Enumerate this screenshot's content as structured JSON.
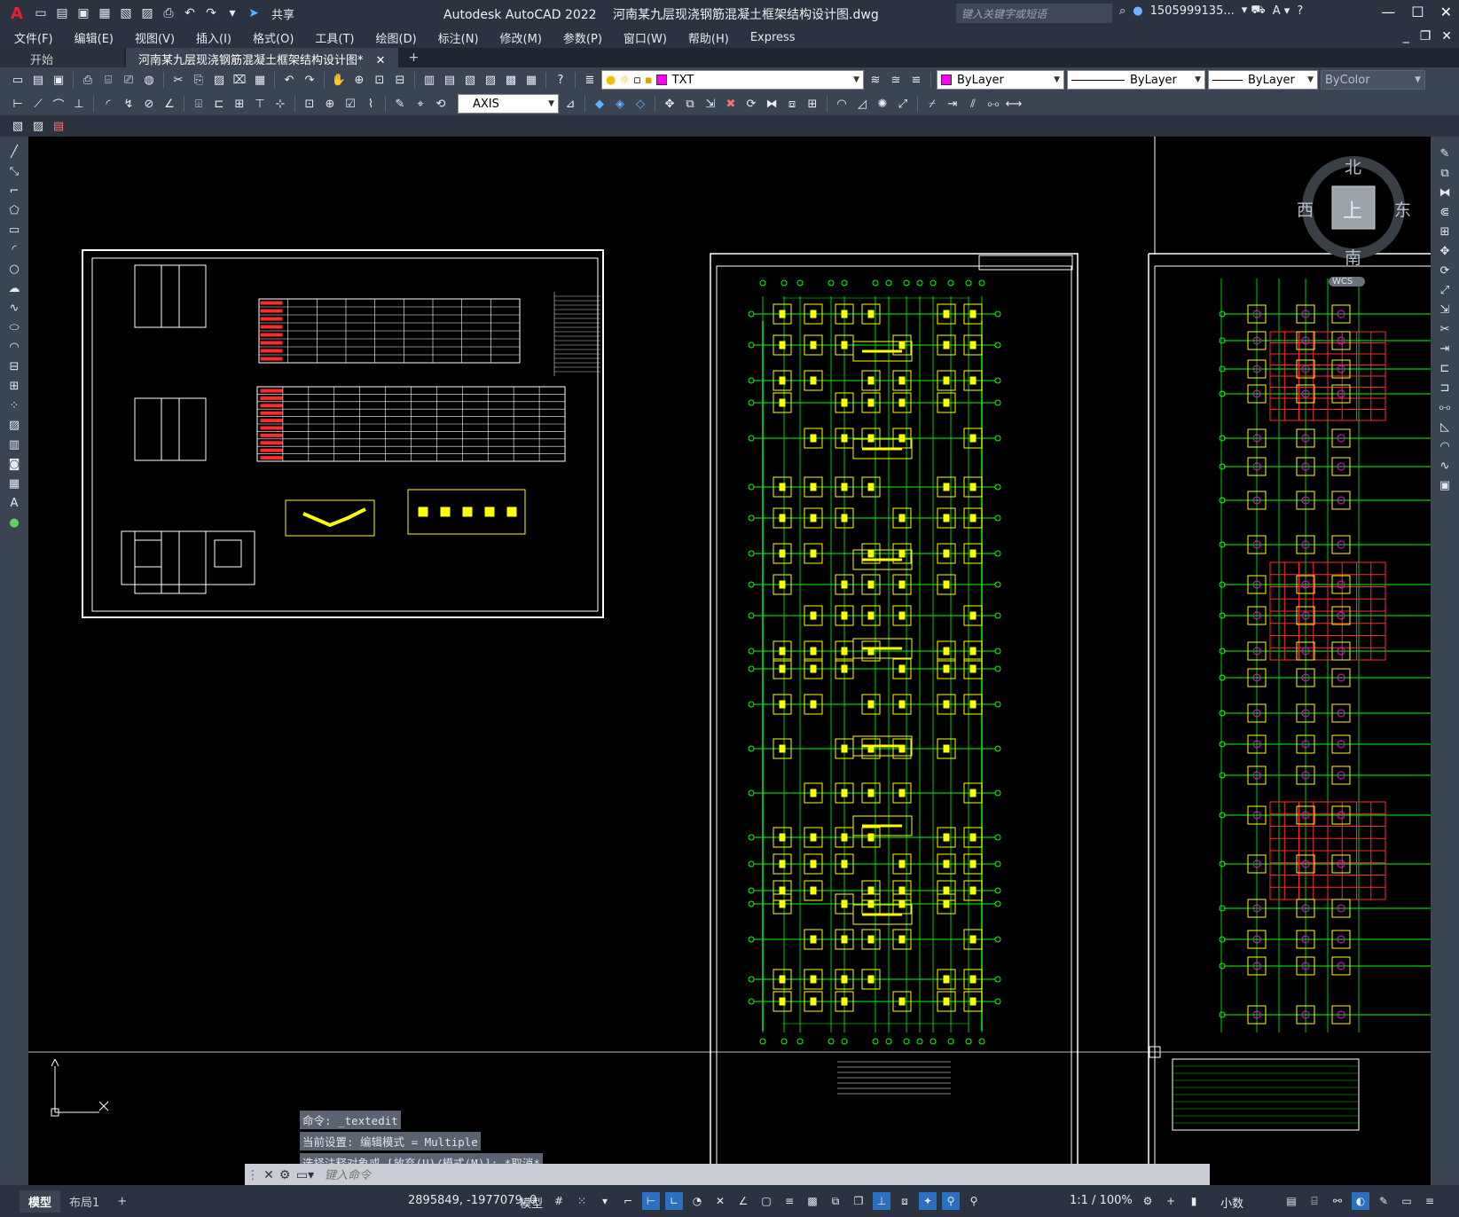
{
  "app": {
    "title": "Autodesk AutoCAD 2022",
    "filename": "河南某九层现浇钢筋混凝土框架结构设计图.dwg",
    "logo": "A",
    "share": "共享",
    "search_placeholder": "键入关键字或短语",
    "user": "1505999135...",
    "help": "?"
  },
  "menu": [
    "文件(F)",
    "编辑(E)",
    "视图(V)",
    "插入(I)",
    "格式(O)",
    "工具(T)",
    "绘图(D)",
    "标注(N)",
    "修改(M)",
    "参数(P)",
    "窗口(W)",
    "帮助(H)",
    "Express"
  ],
  "tabs": [
    {
      "label": "开始",
      "active": false
    },
    {
      "label": "河南某九层现浇钢筋混凝土框架结构设计图*",
      "active": true
    }
  ],
  "layer": {
    "name": "TXT",
    "color": "#ff00ff"
  },
  "properties": {
    "color": "ByLayer",
    "color_swatch": "#ff00ff",
    "linetype": "ByLayer",
    "lineweight": "ByLayer",
    "plotstyle": "ByColor"
  },
  "dimstyle": "AXIS",
  "viewcube": {
    "north": "北",
    "south": "南",
    "east": "东",
    "west": "西",
    "top": "上",
    "wcs": "WCS"
  },
  "command": {
    "history": [
      "命令: _textedit",
      "当前设置: 编辑模式 = Multiple",
      "选择注释对象或 [放弃(U)/模式(M)]: *取消*"
    ],
    "placeholder": "键入命令"
  },
  "status": {
    "layout_tabs": [
      "模型",
      "布局1"
    ],
    "coords": "2895849, -1977079, 0",
    "model": "模型",
    "scale": "1:1 / 100%",
    "units": "小数"
  },
  "colors": {
    "chrome": "#2b3340",
    "toolbar": "#3b4453",
    "grid": "#00ff00",
    "footing": "#ffff00",
    "rebar": "#ff2a2a"
  }
}
